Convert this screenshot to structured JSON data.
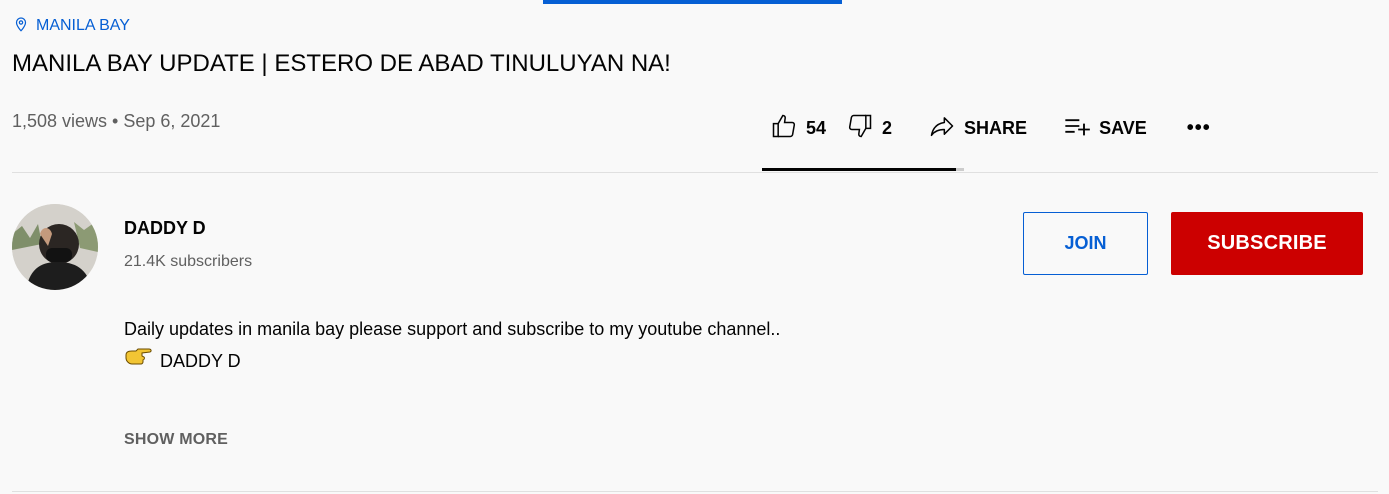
{
  "location": {
    "icon": "location-pin-icon",
    "label": "MANILA BAY"
  },
  "video": {
    "title": "MANILA BAY UPDATE | ESTERO DE ABAD TINULUYAN NA!",
    "meta": "1,508 views • Sep 6, 2021"
  },
  "actions": {
    "likes": "54",
    "dislikes": "2",
    "share": "SHARE",
    "save": "SAVE",
    "more": "•••",
    "like_ratio": 0.96
  },
  "channel": {
    "name": "DADDY D",
    "subscribers": "21.4K subscribers",
    "join": "JOIN",
    "subscribe": "SUBSCRIBE"
  },
  "description": {
    "line1": "Daily updates in manila bay please support and subscribe to my youtube channel..",
    "line2": "DADDY D",
    "line2_icon": "pointing-hand-icon",
    "show_more": "SHOW MORE"
  },
  "colors": {
    "accent": "#065fd4",
    "subscribe": "#cc0000",
    "background": "#f9f9f9",
    "secondary_text": "#606060"
  }
}
